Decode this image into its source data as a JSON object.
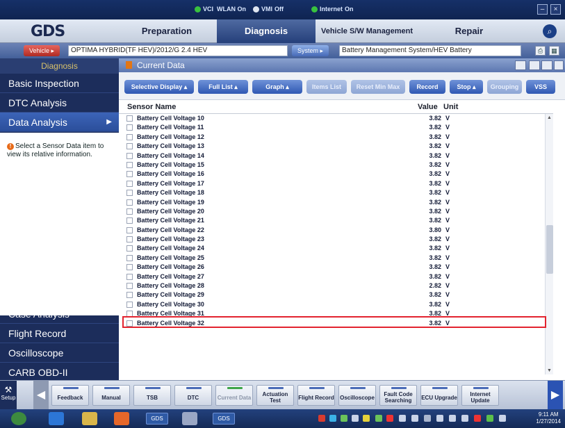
{
  "status": {
    "vci": "VCI",
    "wlan": "WLAN On",
    "vmi": "VMI",
    "vmi_state": "Off",
    "internet": "Internet",
    "internet_state": "On"
  },
  "menu": {
    "logo": "GDS",
    "tabs": [
      "Preparation",
      "Diagnosis",
      "Vehicle S/W Management",
      "Repair"
    ]
  },
  "vehicle": {
    "button": "Vehicle",
    "name": "OPTIMA HYBRID(TF HEV)/2012/G 2.4 HEV",
    "system_button": "System",
    "system_name": "Battery Management System/HEV Battery"
  },
  "sidebar": {
    "header": "Diagnosis",
    "items": [
      "Basic Inspection",
      "DTC Analysis",
      "Data Analysis"
    ],
    "info_text": "Select a Sensor Data item to view its relative information.",
    "bottom_items": [
      "Case Analysis",
      "Flight Record",
      "Oscilloscope",
      "CARB OBD-II"
    ]
  },
  "current_data": {
    "title": "Current Data",
    "toolbar": [
      "Selective Display",
      "Full List",
      "Graph",
      "Items List",
      "Reset Min Max",
      "Record",
      "Stop",
      "Grouping",
      "VSS"
    ],
    "columns": {
      "name": "Sensor Name",
      "value": "Value",
      "unit": "Unit"
    },
    "rows": [
      {
        "name": "Battery Cell Voltage 10",
        "value": "3.82",
        "unit": "V"
      },
      {
        "name": "Battery Cell Voltage 11",
        "value": "3.82",
        "unit": "V"
      },
      {
        "name": "Battery Cell Voltage 12",
        "value": "3.82",
        "unit": "V"
      },
      {
        "name": "Battery Cell Voltage 13",
        "value": "3.82",
        "unit": "V"
      },
      {
        "name": "Battery Cell Voltage 14",
        "value": "3.82",
        "unit": "V"
      },
      {
        "name": "Battery Cell Voltage 15",
        "value": "3.82",
        "unit": "V"
      },
      {
        "name": "Battery Cell Voltage 16",
        "value": "3.82",
        "unit": "V"
      },
      {
        "name": "Battery Cell Voltage 17",
        "value": "3.82",
        "unit": "V"
      },
      {
        "name": "Battery Cell Voltage 18",
        "value": "3.82",
        "unit": "V"
      },
      {
        "name": "Battery Cell Voltage 19",
        "value": "3.82",
        "unit": "V"
      },
      {
        "name": "Battery Cell Voltage 20",
        "value": "3.82",
        "unit": "V"
      },
      {
        "name": "Battery Cell Voltage 21",
        "value": "3.82",
        "unit": "V"
      },
      {
        "name": "Battery Cell Voltage 22",
        "value": "3.80",
        "unit": "V"
      },
      {
        "name": "Battery Cell Voltage 23",
        "value": "3.82",
        "unit": "V"
      },
      {
        "name": "Battery Cell Voltage 24",
        "value": "3.82",
        "unit": "V"
      },
      {
        "name": "Battery Cell Voltage 25",
        "value": "3.82",
        "unit": "V"
      },
      {
        "name": "Battery Cell Voltage 26",
        "value": "3.82",
        "unit": "V"
      },
      {
        "name": "Battery Cell Voltage 27",
        "value": "3.82",
        "unit": "V"
      },
      {
        "name": "Battery Cell Voltage 28",
        "value": "2.82",
        "unit": "V"
      },
      {
        "name": "Battery Cell Voltage 29",
        "value": "3.82",
        "unit": "V"
      },
      {
        "name": "Battery Cell Voltage 30",
        "value": "3.82",
        "unit": "V"
      },
      {
        "name": "Battery Cell Voltage 31",
        "value": "3.82",
        "unit": "V"
      },
      {
        "name": "Battery Cell Voltage 32",
        "value": "3.82",
        "unit": "V"
      }
    ]
  },
  "bottom_toolbar": {
    "setup": "Setup",
    "buttons": [
      "Feedback",
      "Manual",
      "TSB",
      "DTC",
      "Current Data",
      "Actuation Test",
      "Flight Record",
      "Oscilloscope",
      "Fault Code Searching",
      "ECU Upgrade",
      "Internet Update"
    ]
  },
  "taskbar": {
    "apps": [
      "GDS",
      "GDS"
    ],
    "time": "9:11 AM",
    "date": "1/27/2014"
  },
  "colors": {
    "highlight": "#e2232f",
    "accent": "#2f58b3"
  }
}
